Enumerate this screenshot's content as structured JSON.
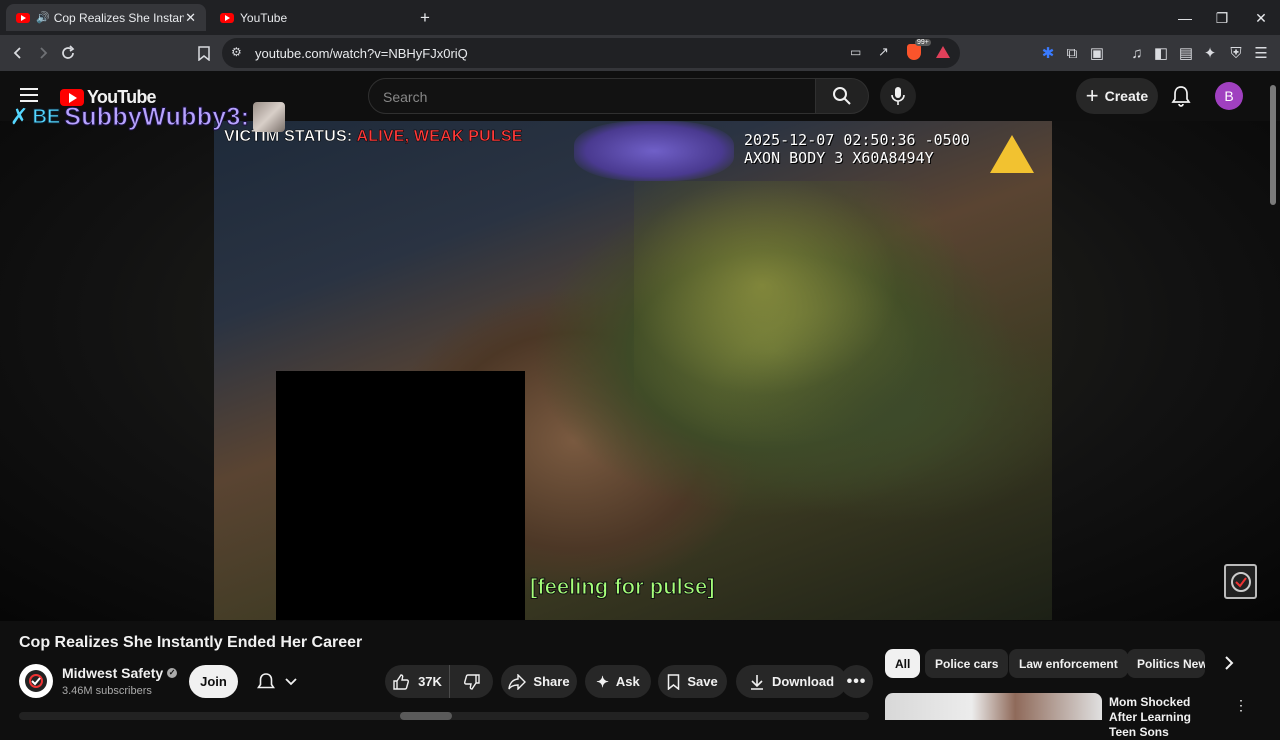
{
  "browser": {
    "tabs": [
      {
        "label": "Cop Realizes She Instantly En",
        "active": true
      },
      {
        "label": "YouTube",
        "active": false
      }
    ],
    "new_tab": "+",
    "url": "youtube.com/watch?v=NBHyFJx0riQ",
    "extension_badge": "99+"
  },
  "masthead": {
    "logo_text": "YouTube",
    "search_placeholder": "Search",
    "create_label": "Create",
    "avatar_letter": "B"
  },
  "overlay": {
    "prefix": "BE",
    "name": "SubbyWubby3:"
  },
  "video": {
    "status_label": "VICTIM STATUS:",
    "status_value": "ALIVE, WEAK PULSE",
    "timestamp_line1": "2025-12-07 02:50:36 -0500",
    "timestamp_line2": "AXON BODY 3 X60A8494Y",
    "caption": "[feeling for pulse]"
  },
  "meta": {
    "title": "Cop Realizes She Instantly Ended Her Career",
    "channel_name": "Midwest Safety",
    "subscribers": "3.46M subscribers",
    "join_label": "Join",
    "like_count": "37K",
    "share_label": "Share",
    "ask_label": "Ask",
    "save_label": "Save",
    "download_label": "Download"
  },
  "chips": [
    "All",
    "Police cars",
    "Law enforcement",
    "Politics New"
  ],
  "recommended": {
    "title": "Mom Shocked After Learning Teen Sons"
  },
  "colors": {
    "status_red": "#ff3a3a",
    "caption_green": "#a6ff7a",
    "overlay_purple": "#b7a3ff",
    "youtube_red": "#ff0000"
  }
}
